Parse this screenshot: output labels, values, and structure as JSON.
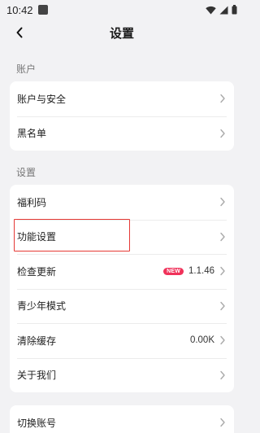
{
  "status_bar": {
    "time": "10:42",
    "icons": [
      "notification-icon",
      "wifi-icon",
      "signal-icon",
      "battery-icon"
    ]
  },
  "header": {
    "back_icon": "back-arrow-icon",
    "title": "设置"
  },
  "sections": [
    {
      "label": "账户",
      "items": [
        {
          "label": "账户与安全"
        },
        {
          "label": "黑名单"
        }
      ]
    },
    {
      "label": "设置",
      "items": [
        {
          "label": "福利码"
        },
        {
          "label": "功能设置",
          "highlighted": true
        },
        {
          "label": "检查更新",
          "badge": "NEW",
          "value": "1.1.46"
        },
        {
          "label": "青少年模式"
        },
        {
          "label": "清除缓存",
          "value": "0.00K"
        },
        {
          "label": "关于我们"
        }
      ]
    },
    {
      "label": "",
      "items": [
        {
          "label": "切换账号"
        }
      ]
    }
  ],
  "colors": {
    "background": "#f2f2f4",
    "card": "#ffffff",
    "badge": "#f0325a",
    "highlight_box": "#e53935"
  }
}
